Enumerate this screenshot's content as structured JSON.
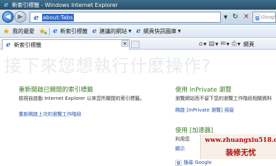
{
  "window": {
    "title": "新索引標籤 - Windows Internet Explorer"
  },
  "addressbar": {
    "url": "about:Tabs",
    "search_placeholder": "Google"
  },
  "favorites_bar": {
    "favorites_label": "我的最愛",
    "items": [
      {
        "label": "新索引標籤"
      },
      {
        "label": "建議的網站"
      },
      {
        "label": "網頁快訊圖庫"
      }
    ]
  },
  "tabs": [
    {
      "label": "新索引標籤"
    }
  ],
  "command_bar": {
    "page_label": "網頁"
  },
  "content": {
    "heading": "接下來您想執行什麼操作?",
    "reopen": {
      "title": "重新開啟已關閉的索引標籤",
      "desc": "檢視自啟動 Internet Explorer 以來您所關閉的索引標籤。",
      "link": "重新開啟上次的瀏覽工作階段"
    },
    "inprivate": {
      "title": "使用 InPrivate 瀏覽",
      "desc": "瀏覽網站而不留下您的瀏覽工作階段相關資料",
      "link": "開啟 [InPrivate 瀏覽] 視窗"
    },
    "accelerator": {
      "title": "使用 [加速器]",
      "desc": "利用您",
      "link": "顯示"
    },
    "search_google": "搜尋 Google"
  },
  "watermark": {
    "url": "www.zhuangxiu518.com",
    "brand": "装修无忧"
  }
}
